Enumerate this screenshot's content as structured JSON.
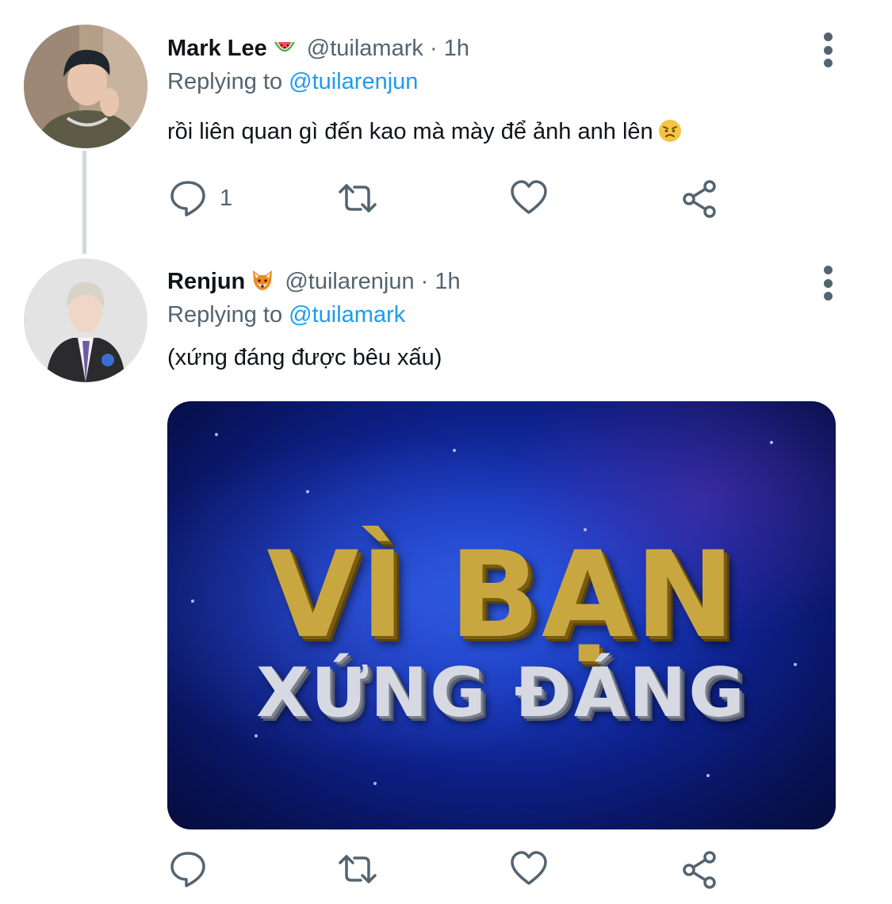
{
  "tweets": [
    {
      "name": "Mark Lee",
      "name_emoji": "watermelon-emoji",
      "handle": "@tuilamark",
      "separator": "·",
      "time": "1h",
      "replying_label": "Replying to",
      "replying_to": "@tuilarenjun",
      "text": "rồi liên quan gì đến kao mà mày để ảnh anh lên",
      "text_emoji": "angry-face-emoji",
      "reply_count": "1"
    },
    {
      "name": "Renjun",
      "name_emoji": "fox-emoji",
      "handle": "@tuilarenjun",
      "separator": "·",
      "time": "1h",
      "replying_label": "Replying to",
      "replying_to": "@tuilamark",
      "text": "(xứng đáng được bêu xấu)",
      "media": {
        "line1": "VÌ BẠN",
        "line2": "XỨNG ĐÁNG"
      }
    }
  ],
  "colors": {
    "link": "#1d9bf0",
    "secondary_text": "#536471",
    "thread_line": "#cfd9de",
    "media_gold": "#c9a740",
    "media_silver": "#d6d9e2"
  }
}
